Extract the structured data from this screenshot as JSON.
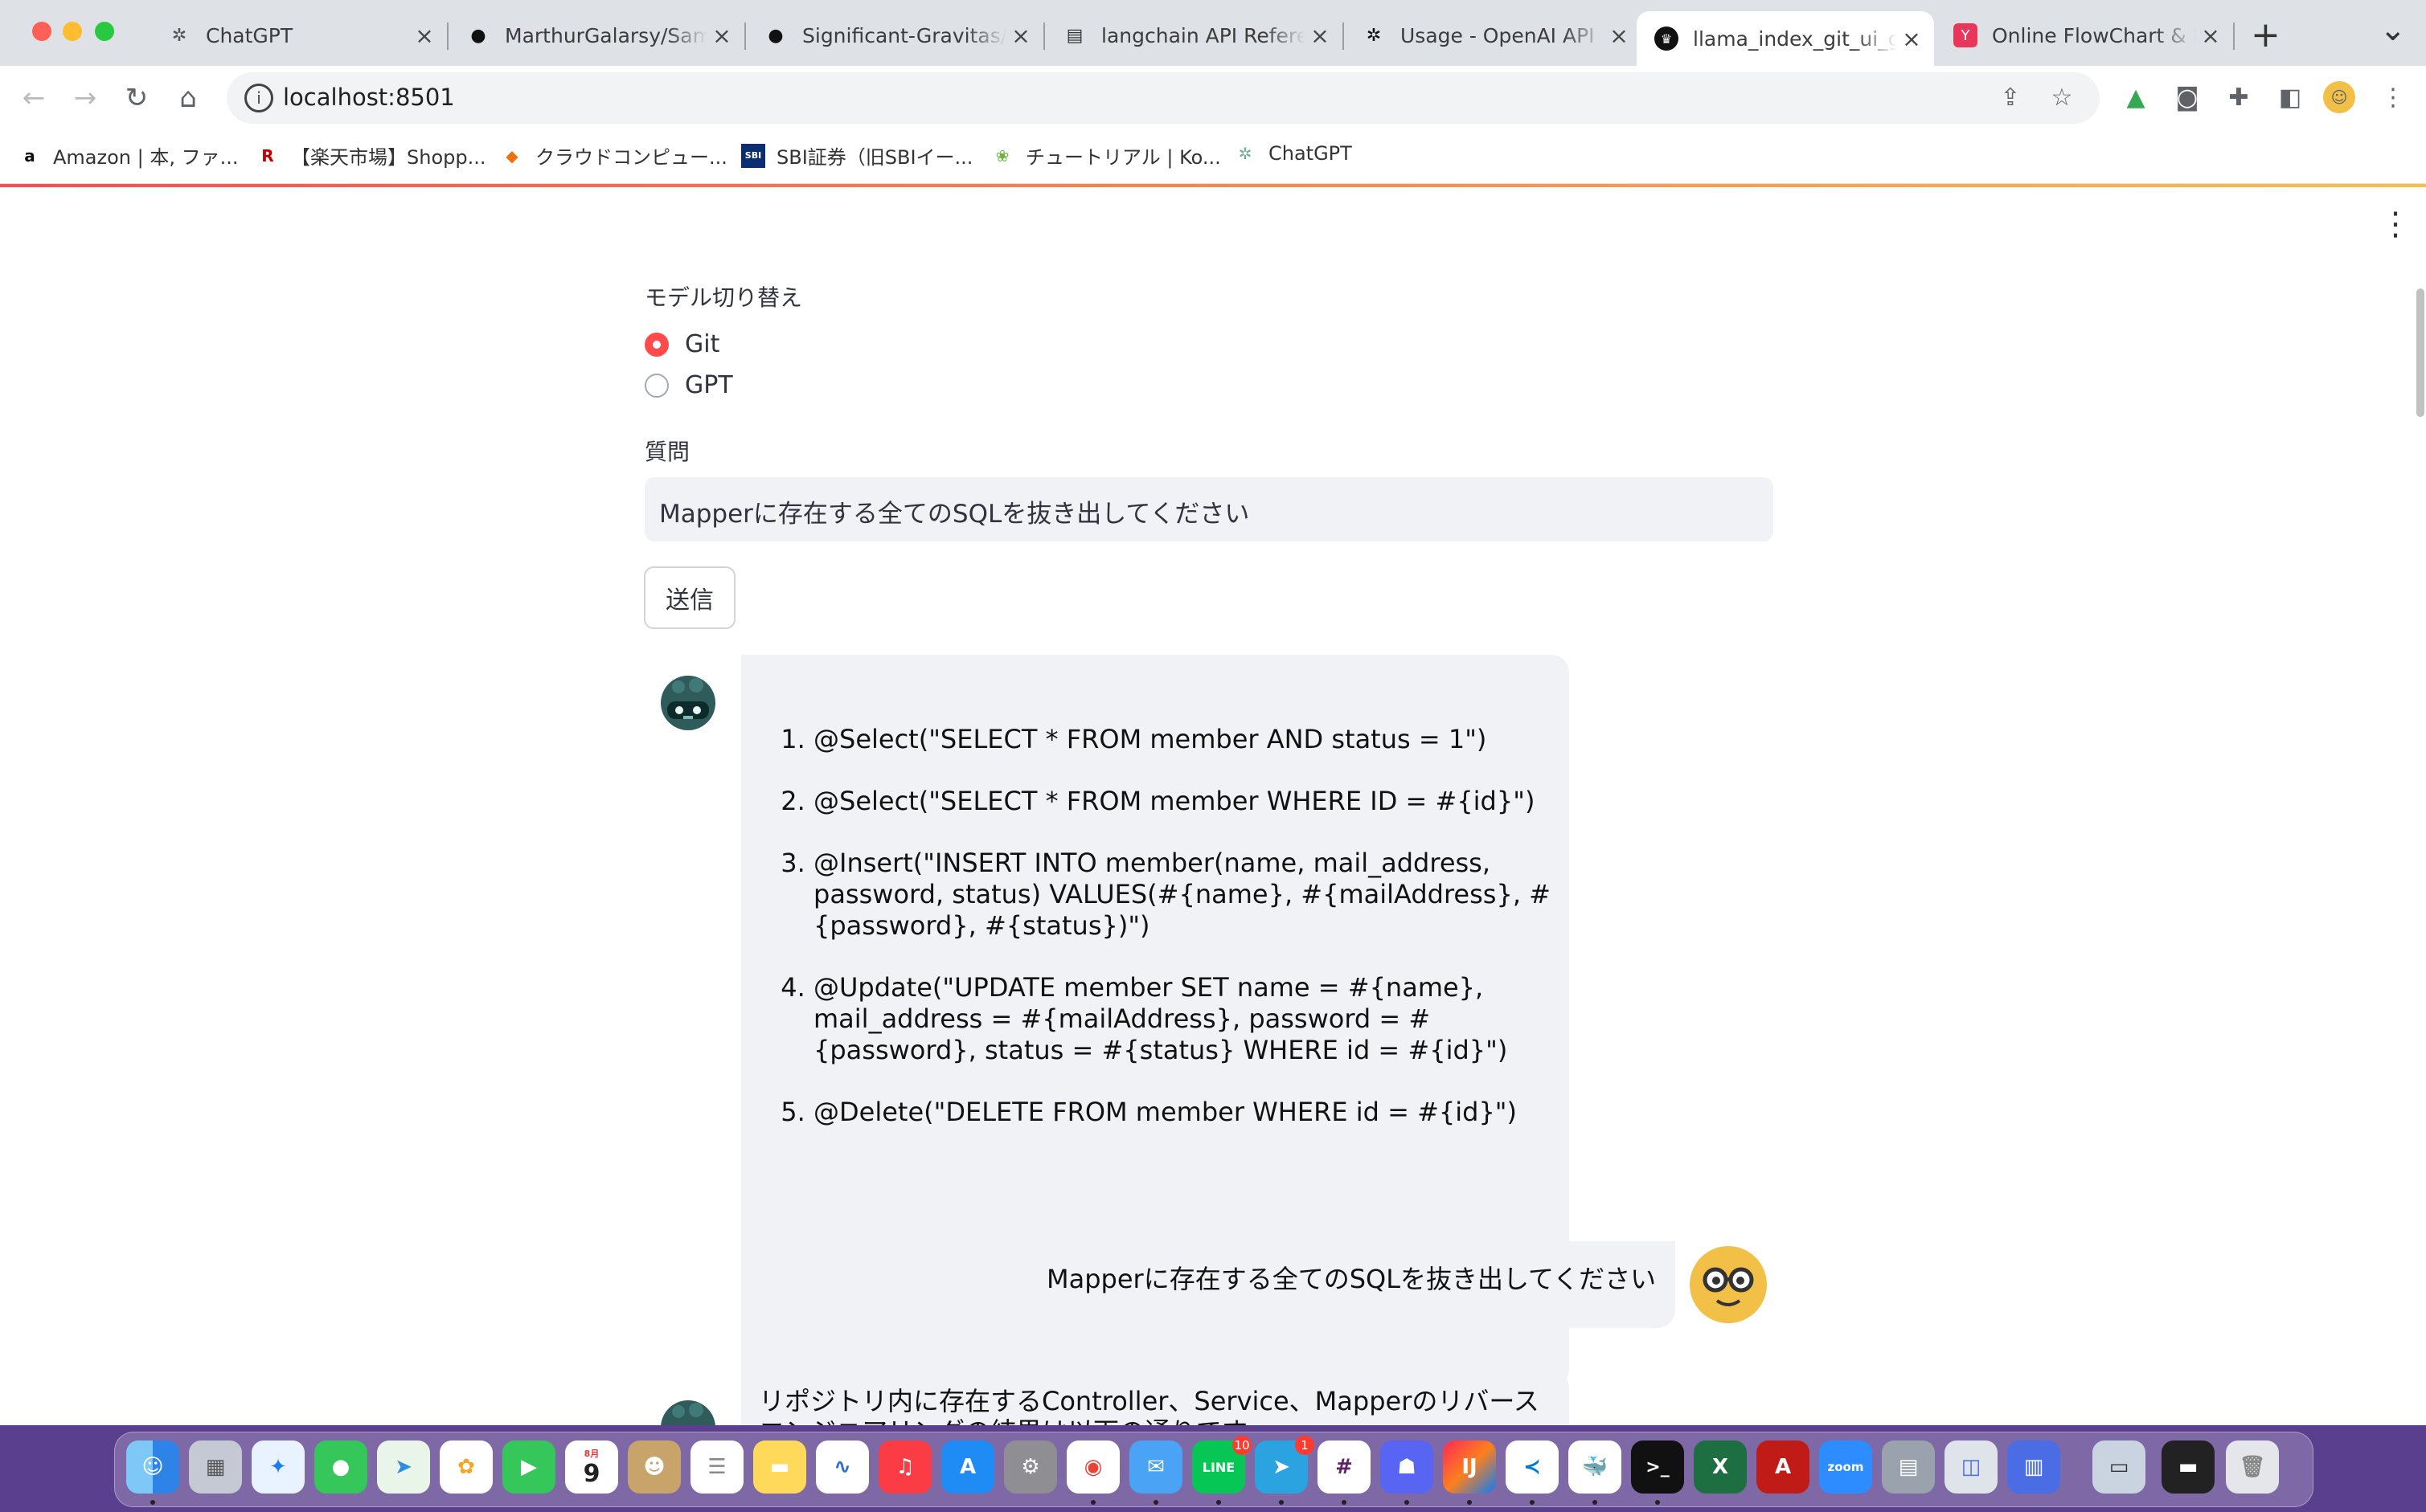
{
  "browser": {
    "tabs": [
      {
        "title": "ChatGPT",
        "icon": "chatgpt-icon",
        "close": "×"
      },
      {
        "title": "MarthurGalarsy/Samp",
        "icon": "github-icon",
        "close": "×"
      },
      {
        "title": "Significant-Gravitas/",
        "icon": "github-icon",
        "close": "×"
      },
      {
        "title": "langchain API Referen",
        "icon": "book-icon",
        "close": "×"
      },
      {
        "title": "Usage - OpenAI API",
        "icon": "openai-icon",
        "close": "×"
      },
      {
        "title": "llama_index_git_ui_g",
        "icon": "streamlit-icon",
        "close": "×"
      },
      {
        "title": "Online FlowChart & D",
        "icon": "flowchart-icon",
        "close": "×"
      }
    ],
    "new_tab": "+",
    "tab_menu": "⌄",
    "url": "localhost:8501",
    "bookmarks": [
      {
        "label": "Amazon | 本, ファ...",
        "icon": "amazon-icon",
        "glyph": "a"
      },
      {
        "label": "【楽天市場】Shopp...",
        "icon": "rakuten-icon",
        "glyph": "R"
      },
      {
        "label": "クラウドコンピュー...",
        "icon": "aws-icon",
        "glyph": "◆"
      },
      {
        "label": "SBI証券（旧SBIイー...",
        "icon": "sbi-icon",
        "glyph": "SBI"
      },
      {
        "label": "チュートリアル | Ko...",
        "icon": "spring-icon",
        "glyph": "❀"
      },
      {
        "label": "ChatGPT",
        "icon": "chatgpt-icon",
        "glyph": "✲"
      }
    ]
  },
  "app": {
    "model_label": "モデル切り替え",
    "model_options": [
      {
        "label": "Git",
        "selected": true
      },
      {
        "label": "GPT",
        "selected": false
      }
    ],
    "question_label": "質問",
    "question_value": "Mapperに存在する全てのSQLを抜き出してください",
    "send_label": "送信",
    "bot_answer": [
      "@Select(\"SELECT * FROM member AND status = 1\")",
      "@Select(\"SELECT * FROM member WHERE ID = #{id}\")",
      "@Insert(\"INSERT INTO member(name, mail_address, password, status) VALUES(#{name}, #{mailAddress}, #{password}, #{status})\")",
      "@Update(\"UPDATE member SET name = #{name}, mail_address = #{mailAddress}, password = #{password}, status = #{status} WHERE id = #{id}\")",
      "@Delete(\"DELETE FROM member WHERE id = #{id}\")"
    ],
    "user_message": "Mapperに存在する全てのSQLを抜き出してください",
    "bot_partial": "リポジトリ内に存在するController、Service、Mapperのリバース エンジニアリングの結果は以下の通りです。"
  },
  "dock": {
    "calendar_month": "8月",
    "calendar_day": "9",
    "line_badge": "10",
    "telegram_badge": "1"
  },
  "colors": {
    "accent": "#ff4b4b",
    "chat_bg": "#f0f2f6",
    "desktop": "#5a3f8e"
  }
}
